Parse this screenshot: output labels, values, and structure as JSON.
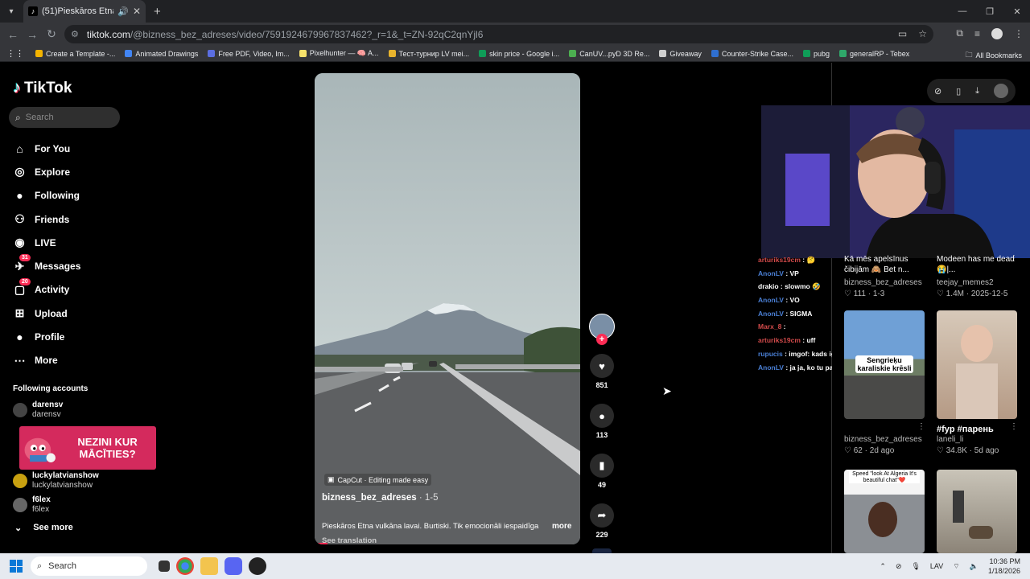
{
  "browser": {
    "tab_title": "(51)Pieskāros Etna vulkāna l",
    "url_host": "tiktok.com",
    "url_path": "/@bizness_bez_adreses/video/7591924679967837462?_r=1&_t=ZN-92qC2qnYjl6",
    "bookmarks": [
      "Create a Template -...",
      "Animated Drawings",
      "Free PDF, Video, Im...",
      "Pixelhunter — 🧠 A...",
      "Тест-турнир LV mei...",
      "skin price - Google i...",
      "CanUV...pyD 3D Re...",
      "Giveaway",
      "Counter-Strike Case...",
      "pubg",
      "generalRP - Tebex"
    ],
    "all_bookmarks": "All Bookmarks"
  },
  "sidebar": {
    "logo": "TikTok",
    "search_placeholder": "Search",
    "nav": [
      {
        "label": "For You",
        "icon": "home-icon"
      },
      {
        "label": "Explore",
        "icon": "compass-icon"
      },
      {
        "label": "Following",
        "icon": "following-icon"
      },
      {
        "label": "Friends",
        "icon": "friends-icon"
      },
      {
        "label": "LIVE",
        "icon": "live-icon"
      },
      {
        "label": "Messages",
        "icon": "messages-icon",
        "badge": "31"
      },
      {
        "label": "Activity",
        "icon": "activity-icon",
        "badge": "20"
      },
      {
        "label": "Upload",
        "icon": "upload-icon"
      },
      {
        "label": "Profile",
        "icon": "profile-icon"
      },
      {
        "label": "More",
        "icon": "more-icon"
      }
    ],
    "following_title": "Following accounts",
    "accounts": [
      {
        "name": "darensv",
        "handle": "darensv"
      },
      {
        "name": "luckylatvianshow",
        "handle": "luckylatvianshow"
      },
      {
        "name": "f6lex",
        "handle": "f6lex"
      }
    ],
    "promo_text": "NEZINI KUR MĀCĪTIES?",
    "see_more": "See more"
  },
  "video": {
    "capcut": "CapCut · Editing made easy",
    "author": "bizness_bez_adreses",
    "date": " · 1-5",
    "caption": "Pieskāros Etna vulkāna lavai. Burtiski. Tik emocionāli iespaidīga",
    "more": "more",
    "see_translation": "See translation",
    "likes": "851",
    "comments": "113",
    "saves": "49",
    "shares": "229"
  },
  "chat": [
    {
      "user": "arturiks19cm",
      "msg": "🤔"
    },
    {
      "user": "AnonLV",
      "msg": "VP"
    },
    {
      "user": "drakio",
      "msg": "slowmo 🤣"
    },
    {
      "user": "AnonLV",
      "msg": "VO"
    },
    {
      "user": "AnonLV",
      "msg": "SIGMA"
    },
    {
      "user": "Marx_8",
      "msg": ""
    },
    {
      "user": "arturiks19cm",
      "msg": "uff"
    },
    {
      "user": "rupucis",
      "msg": "imgof: kads ig"
    },
    {
      "user": "AnonLV",
      "msg": "ja ja, ko tu pauzē"
    }
  ],
  "grid": [
    {
      "caption": "Kā mēs apelsīnus čibijām 🙈 Bet n...",
      "author": "bizness_bez_adreses",
      "likes": "111",
      "date": "1-3"
    },
    {
      "caption": "Modeen has me dead 😭|...",
      "author": "teejay_memes2",
      "likes": "1.4M",
      "date": "2025-12-5"
    },
    {
      "caption": "",
      "author": "bizness_bez_adreses",
      "likes": "62",
      "date": "2d ago",
      "overlay": "Sengrieķu karaliskie krēsli"
    },
    {
      "caption": "#fyp #парень",
      "author": "laneli_li",
      "likes": "34.8K",
      "date": "5d ago"
    },
    {
      "overlay": "Speed \"look At Algeria It's beautiful chat\"❤️"
    }
  ],
  "taskbar": {
    "search": "Search",
    "lang": "LAV",
    "time": "10:36 PM",
    "date": "1/18/2026"
  }
}
